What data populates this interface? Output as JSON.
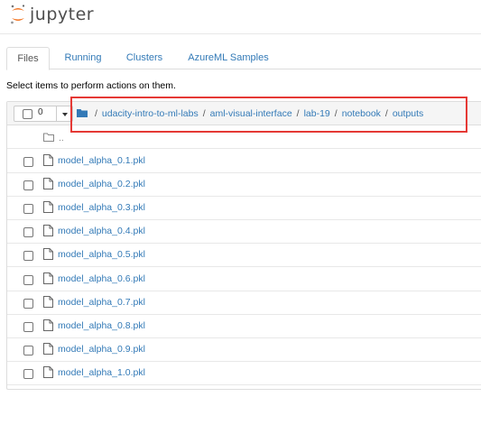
{
  "header": {
    "logo_text": "jupyter"
  },
  "tabs": [
    {
      "label": "Files",
      "active": true
    },
    {
      "label": "Running",
      "active": false
    },
    {
      "label": "Clusters",
      "active": false
    },
    {
      "label": "AzureML Samples",
      "active": false
    }
  ],
  "hint": "Select items to perform actions on them.",
  "toolbar": {
    "selected_count": "0"
  },
  "breadcrumb": {
    "separator": "/",
    "items": [
      "udacity-intro-to-ml-labs",
      "aml-visual-interface",
      "lab-19",
      "notebook",
      "outputs"
    ]
  },
  "parent_row": {
    "label": ".."
  },
  "files": [
    "model_alpha_0.1.pkl",
    "model_alpha_0.2.pkl",
    "model_alpha_0.3.pkl",
    "model_alpha_0.4.pkl",
    "model_alpha_0.5.pkl",
    "model_alpha_0.6.pkl",
    "model_alpha_0.7.pkl",
    "model_alpha_0.8.pkl",
    "model_alpha_0.9.pkl",
    "model_alpha_1.0.pkl"
  ],
  "colors": {
    "link": "#337ab7",
    "highlight": "#e53935",
    "logo_orange": "#f37726"
  },
  "icons": {
    "logo": "jupyter-logo-icon",
    "home": "folder-icon",
    "file": "file-icon",
    "parent": "folder-outline-icon"
  }
}
